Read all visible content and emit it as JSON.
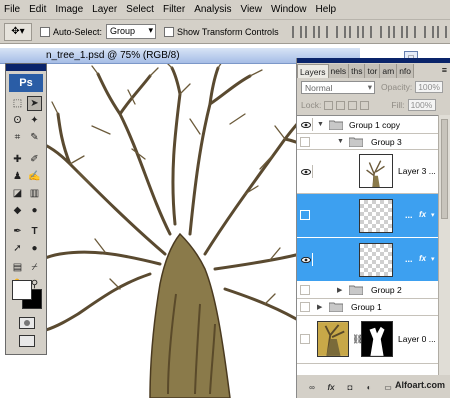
{
  "menu": [
    "File",
    "Edit",
    "Image",
    "Layer",
    "Select",
    "Filter",
    "Analysis",
    "View",
    "Window",
    "Help"
  ],
  "options": {
    "auto_select_label": "Auto-Select:",
    "auto_select_value": "Group",
    "show_transform_label": "Show Transform Controls"
  },
  "document": {
    "title": "n_tree_1.psd @ 75% (RGB/8)"
  },
  "tools": {
    "logo": "Ps",
    "foreground_color": "#ffffff",
    "background_color": "#000000"
  },
  "layers_panel": {
    "tabs": [
      "Layers",
      "nels",
      "ths",
      "tor",
      "am",
      "nfo"
    ],
    "blend_mode": "Normal",
    "opacity_label": "Opacity:",
    "opacity_value": "100%",
    "lock_label": "Lock:",
    "fill_label": "Fill:",
    "fill_value": "100%",
    "layers": [
      {
        "name": "Group 1 copy",
        "type": "group",
        "visible": true,
        "expanded": true
      },
      {
        "name": "Group 3",
        "type": "group",
        "visible": false,
        "expanded": true
      },
      {
        "name": "Layer 3 ...",
        "type": "layer",
        "visible": true
      },
      {
        "name": "...",
        "type": "layer",
        "visible": false,
        "fx": "fx",
        "selected": true
      },
      {
        "name": "...",
        "type": "layer",
        "visible": true,
        "fx": "fx",
        "selected": true
      },
      {
        "name": "Group 2",
        "type": "group",
        "visible": false,
        "expanded": false
      },
      {
        "name": "Group 1",
        "type": "group",
        "visible": false,
        "expanded": false
      },
      {
        "name": "Layer 0 ...",
        "type": "layer",
        "visible": true
      }
    ],
    "footer_fx": "fx",
    "watermark": "Alfoart.com"
  },
  "colors": {
    "selection": "#3da0f0",
    "panel_gray": "#d4d0c8",
    "title_blue": "#0a246a"
  }
}
